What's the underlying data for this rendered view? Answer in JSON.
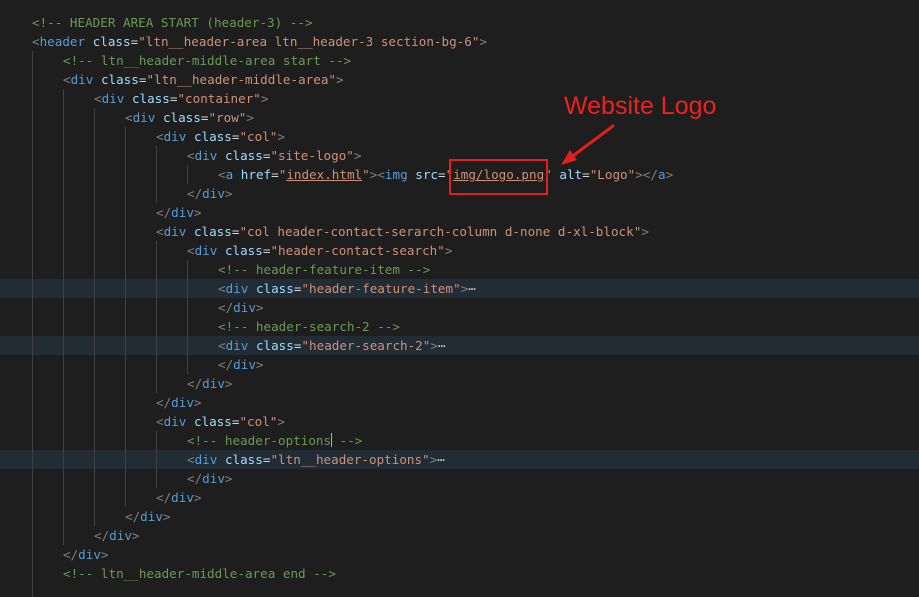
{
  "editor": {
    "colors": {
      "background": "#1e1e1e",
      "comment": "#6a9955",
      "tag": "#569cd6",
      "attribute": "#9cdcfe",
      "string": "#ce9178",
      "punctuation": "#808080",
      "text": "#d4d4d4",
      "folded_line_bg": "#212c35",
      "annotation": "#e0201e"
    },
    "lines": [
      {
        "indent": 0,
        "tokens": [
          [
            "c",
            "<!-- HEADER AREA START (header-3) -->"
          ]
        ]
      },
      {
        "indent": 0,
        "tokens": [
          [
            "p",
            "<"
          ],
          [
            "t",
            "header"
          ],
          [
            "txt",
            " "
          ],
          [
            "a",
            "class"
          ],
          [
            "txt",
            "="
          ],
          [
            "v",
            "\"ltn__header-area ltn__header-3 section-bg-6\""
          ],
          [
            "p",
            ">"
          ]
        ]
      },
      {
        "indent": 1,
        "tokens": [
          [
            "c",
            "<!-- ltn__header-middle-area start -->"
          ]
        ]
      },
      {
        "indent": 1,
        "tokens": [
          [
            "p",
            "<"
          ],
          [
            "t",
            "div"
          ],
          [
            "txt",
            " "
          ],
          [
            "a",
            "class"
          ],
          [
            "txt",
            "="
          ],
          [
            "v",
            "\"ltn__header-middle-area\""
          ],
          [
            "p",
            ">"
          ]
        ]
      },
      {
        "indent": 2,
        "tokens": [
          [
            "p",
            "<"
          ],
          [
            "t",
            "div"
          ],
          [
            "txt",
            " "
          ],
          [
            "a",
            "class"
          ],
          [
            "txt",
            "="
          ],
          [
            "v",
            "\"container\""
          ],
          [
            "p",
            ">"
          ]
        ]
      },
      {
        "indent": 3,
        "tokens": [
          [
            "p",
            "<"
          ],
          [
            "t",
            "div"
          ],
          [
            "txt",
            " "
          ],
          [
            "a",
            "class"
          ],
          [
            "txt",
            "="
          ],
          [
            "v",
            "\"row\""
          ],
          [
            "p",
            ">"
          ]
        ]
      },
      {
        "indent": 4,
        "tokens": [
          [
            "p",
            "<"
          ],
          [
            "t",
            "div"
          ],
          [
            "txt",
            " "
          ],
          [
            "a",
            "class"
          ],
          [
            "txt",
            "="
          ],
          [
            "v",
            "\"col\""
          ],
          [
            "p",
            ">"
          ]
        ]
      },
      {
        "indent": 5,
        "tokens": [
          [
            "p",
            "<"
          ],
          [
            "t",
            "div"
          ],
          [
            "txt",
            " "
          ],
          [
            "a",
            "class"
          ],
          [
            "txt",
            "="
          ],
          [
            "v",
            "\"site-logo\""
          ],
          [
            "p",
            ">"
          ]
        ]
      },
      {
        "indent": 6,
        "tokens": [
          [
            "p",
            "<"
          ],
          [
            "t",
            "a"
          ],
          [
            "txt",
            " "
          ],
          [
            "a",
            "href"
          ],
          [
            "txt",
            "="
          ],
          [
            "v",
            "\""
          ],
          [
            "vu",
            "index.html"
          ],
          [
            "v",
            "\""
          ],
          [
            "p",
            "><"
          ],
          [
            "t",
            "img"
          ],
          [
            "txt",
            " "
          ],
          [
            "a",
            "src"
          ],
          [
            "txt",
            "="
          ],
          [
            "v",
            "\""
          ],
          [
            "vu",
            "img/logo.png"
          ],
          [
            "v",
            "\""
          ],
          [
            "txt",
            " "
          ],
          [
            "a",
            "alt"
          ],
          [
            "txt",
            "="
          ],
          [
            "v",
            "\"Logo\""
          ],
          [
            "p",
            "></"
          ],
          [
            "t",
            "a"
          ],
          [
            "p",
            ">"
          ]
        ]
      },
      {
        "indent": 5,
        "tokens": [
          [
            "p",
            "</"
          ],
          [
            "t",
            "div"
          ],
          [
            "p",
            ">"
          ]
        ]
      },
      {
        "indent": 4,
        "tokens": [
          [
            "p",
            "</"
          ],
          [
            "t",
            "div"
          ],
          [
            "p",
            ">"
          ]
        ]
      },
      {
        "indent": 4,
        "tokens": [
          [
            "p",
            "<"
          ],
          [
            "t",
            "div"
          ],
          [
            "txt",
            " "
          ],
          [
            "a",
            "class"
          ],
          [
            "txt",
            "="
          ],
          [
            "v",
            "\"col header-contact-serarch-column d-none d-xl-block\""
          ],
          [
            "p",
            ">"
          ]
        ]
      },
      {
        "indent": 5,
        "tokens": [
          [
            "p",
            "<"
          ],
          [
            "t",
            "div"
          ],
          [
            "txt",
            " "
          ],
          [
            "a",
            "class"
          ],
          [
            "txt",
            "="
          ],
          [
            "v",
            "\"header-contact-search\""
          ],
          [
            "p",
            ">"
          ]
        ]
      },
      {
        "indent": 6,
        "tokens": [
          [
            "c",
            "<!-- header-feature-item -->"
          ]
        ]
      },
      {
        "indent": 6,
        "folded": true,
        "tokens": [
          [
            "p",
            "<"
          ],
          [
            "t",
            "div"
          ],
          [
            "txt",
            " "
          ],
          [
            "a",
            "class"
          ],
          [
            "txt",
            "="
          ],
          [
            "v",
            "\"header-feature-item\""
          ],
          [
            "p",
            ">"
          ],
          [
            "ell",
            "⋯"
          ]
        ]
      },
      {
        "indent": 6,
        "tokens": [
          [
            "p",
            "</"
          ],
          [
            "t",
            "div"
          ],
          [
            "p",
            ">"
          ]
        ]
      },
      {
        "indent": 6,
        "tokens": [
          [
            "c",
            "<!-- header-search-2 -->"
          ]
        ]
      },
      {
        "indent": 6,
        "folded": true,
        "tokens": [
          [
            "p",
            "<"
          ],
          [
            "t",
            "div"
          ],
          [
            "txt",
            " "
          ],
          [
            "a",
            "class"
          ],
          [
            "txt",
            "="
          ],
          [
            "v",
            "\"header-search-2\""
          ],
          [
            "p",
            ">"
          ],
          [
            "ell",
            "⋯"
          ]
        ]
      },
      {
        "indent": 6,
        "tokens": [
          [
            "p",
            "</"
          ],
          [
            "t",
            "div"
          ],
          [
            "p",
            ">"
          ]
        ]
      },
      {
        "indent": 5,
        "tokens": [
          [
            "p",
            "</"
          ],
          [
            "t",
            "div"
          ],
          [
            "p",
            ">"
          ]
        ]
      },
      {
        "indent": 4,
        "tokens": [
          [
            "p",
            "</"
          ],
          [
            "t",
            "div"
          ],
          [
            "p",
            ">"
          ]
        ]
      },
      {
        "indent": 4,
        "tokens": [
          [
            "p",
            "<"
          ],
          [
            "t",
            "div"
          ],
          [
            "txt",
            " "
          ],
          [
            "a",
            "class"
          ],
          [
            "txt",
            "="
          ],
          [
            "v",
            "\"col\""
          ],
          [
            "p",
            ">"
          ]
        ]
      },
      {
        "indent": 5,
        "tokens": [
          [
            "c",
            "<!-- header-options"
          ],
          [
            "cursor",
            ""
          ],
          [
            "c",
            " -->"
          ]
        ]
      },
      {
        "indent": 5,
        "folded": true,
        "tokens": [
          [
            "p",
            "<"
          ],
          [
            "t",
            "div"
          ],
          [
            "txt",
            " "
          ],
          [
            "a",
            "class"
          ],
          [
            "txt",
            "="
          ],
          [
            "v",
            "\"ltn__header-options\""
          ],
          [
            "p",
            ">"
          ],
          [
            "ell",
            "⋯"
          ]
        ]
      },
      {
        "indent": 5,
        "tokens": [
          [
            "p",
            "</"
          ],
          [
            "t",
            "div"
          ],
          [
            "p",
            ">"
          ]
        ]
      },
      {
        "indent": 4,
        "tokens": [
          [
            "p",
            "</"
          ],
          [
            "t",
            "div"
          ],
          [
            "p",
            ">"
          ]
        ]
      },
      {
        "indent": 3,
        "tokens": [
          [
            "p",
            "</"
          ],
          [
            "t",
            "div"
          ],
          [
            "p",
            ">"
          ]
        ]
      },
      {
        "indent": 2,
        "tokens": [
          [
            "p",
            "</"
          ],
          [
            "t",
            "div"
          ],
          [
            "p",
            ">"
          ]
        ]
      },
      {
        "indent": 1,
        "tokens": [
          [
            "p",
            "</"
          ],
          [
            "t",
            "div"
          ],
          [
            "p",
            ">"
          ]
        ]
      },
      {
        "indent": 1,
        "tokens": [
          [
            "c",
            "<!-- ltn__header-middle-area end -->"
          ]
        ]
      },
      {
        "indent": 1,
        "tokens": []
      }
    ]
  },
  "annotation": {
    "label": "Website Logo",
    "highlighted_text": "img/logo.png",
    "icon": "red-arrow-icon"
  }
}
